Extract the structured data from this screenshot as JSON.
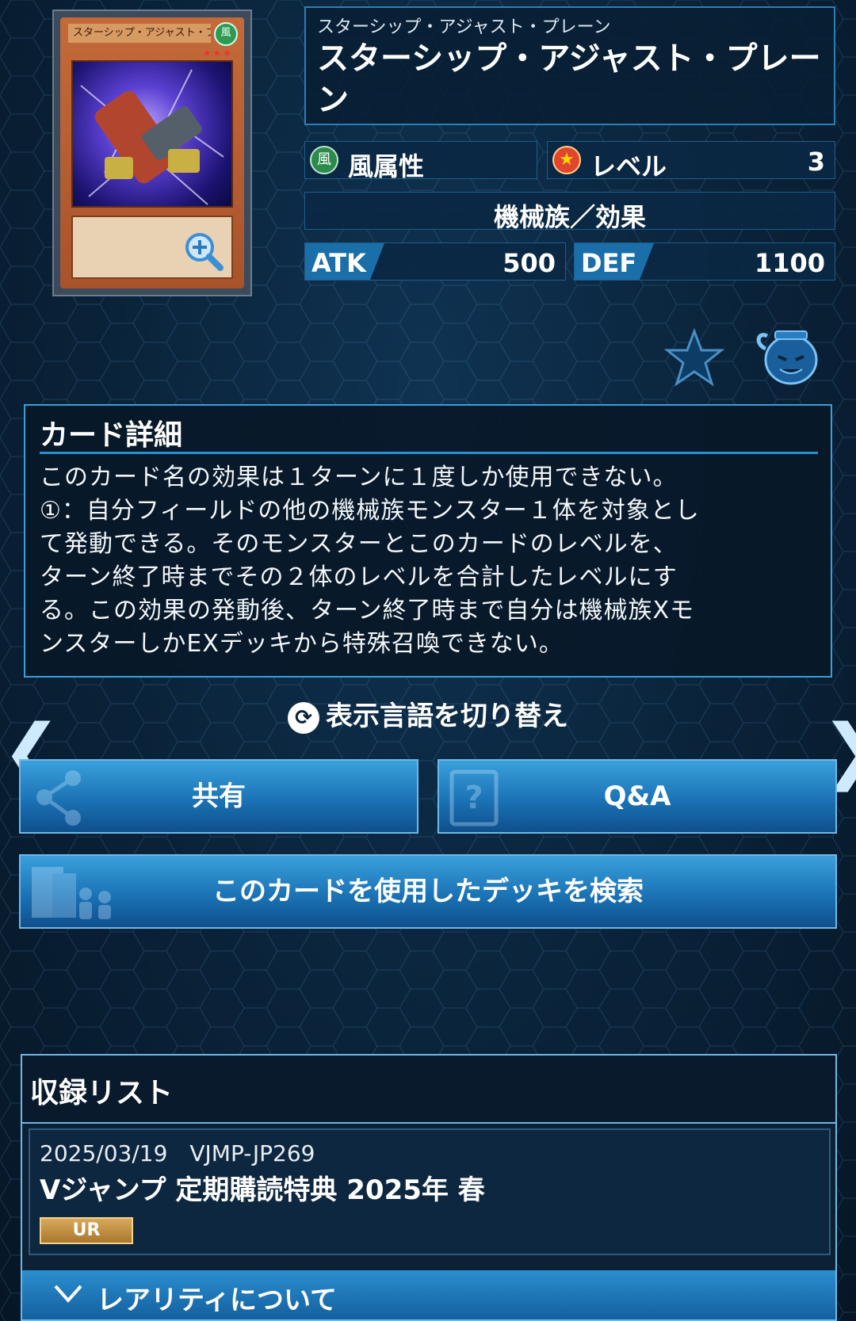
{
  "card": {
    "image_name": "スターシップ・アジャスト・プレーン",
    "image_attribute": "風",
    "image_stars": "★★★",
    "ruby": "スターシップ・アジャスト・プレーン",
    "name": "スターシップ・アジャスト・プレーン",
    "attribute_icon": "風",
    "attribute": "風属性",
    "level_label": "レベル",
    "level": "3",
    "type": "機械族／効果",
    "atk_label": "ATK",
    "atk": "500",
    "def_label": "DEF",
    "def": "1100"
  },
  "icons": {
    "favorite": "star-icon",
    "pot": "pot-of-greed-icon",
    "switch": "refresh-icon",
    "share": "share-icon",
    "qa": "question-card-icon",
    "deck_search": "deck-people-icon",
    "chevron": "chevron-down-icon"
  },
  "detail": {
    "heading": "カード詳細",
    "text": "このカード名の効果は１ターンに１度しか使用できない。\n①：自分フィールドの他の機械族モンスター１体を対象とし\nて発動できる。そのモンスターとこのカードのレベルを、\nターン終了時までその２体のレベルを合計したレベルにす\nる。この効果の発動後、ターン終了時まで自分は機械族Xモ\nンスターしかEXデッキから特殊召喚できない。"
  },
  "switch_language": "表示言語を切り替え",
  "nav": {
    "prev": "❮",
    "next": "❯"
  },
  "buttons": {
    "share": "共有",
    "qa": "Q&A",
    "deck_search": "このカードを使用したデッキを検索"
  },
  "record_list": {
    "heading": "収録リスト",
    "items": [
      {
        "date_code": "2025/03/19　VJMP-JP269",
        "title": "Vジャンプ 定期購読特典 2025年 春",
        "rarity": "UR"
      }
    ],
    "rarity_about": "レアリティについて"
  },
  "colors": {
    "background": "#0a2238",
    "accent": "#2a8fd0",
    "button": "#1b73b5",
    "rarity_gold": "#c8963f"
  }
}
